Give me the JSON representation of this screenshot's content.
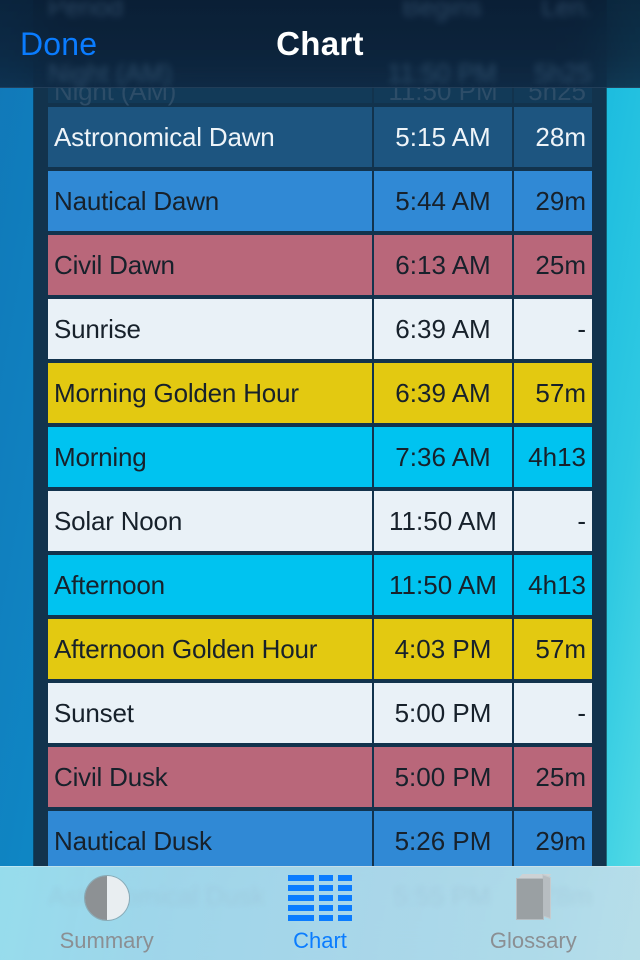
{
  "navbar": {
    "done_label": "Done",
    "title": "Chart",
    "done_color": "#0a7cff",
    "ghost": {
      "header": {
        "period": "Period",
        "begins": "Begins",
        "length": "Len."
      },
      "row": {
        "period": "Night (AM)",
        "begins": "11:50 PM",
        "length": "5h25"
      }
    }
  },
  "table": {
    "columns": [
      "Period",
      "Begins",
      "Len."
    ],
    "partial_top_row": {
      "period": "Night (AM)",
      "begins": "11:50 PM",
      "length": "5h25"
    },
    "rows": [
      {
        "period": "Astronomical Dawn",
        "begins": "5:15 AM",
        "length": "28m",
        "bg": "#1d5580",
        "fg": "#eef4f8"
      },
      {
        "period": "Nautical Dawn",
        "begins": "5:44 AM",
        "length": "29m",
        "bg": "#3089d5",
        "fg": "#17212b"
      },
      {
        "period": "Civil Dawn",
        "begins": "6:13 AM",
        "length": "25m",
        "bg": "#b9677a",
        "fg": "#17212b"
      },
      {
        "period": "Sunrise",
        "begins": "6:39 AM",
        "length": "-",
        "bg": "#e9f1f7",
        "fg": "#17212b"
      },
      {
        "period": "Morning Golden Hour",
        "begins": "6:39 AM",
        "length": "57m",
        "bg": "#e3c911",
        "fg": "#17212b"
      },
      {
        "period": "Morning",
        "begins": "7:36 AM",
        "length": "4h13",
        "bg": "#00c3f0",
        "fg": "#17212b"
      },
      {
        "period": "Solar Noon",
        "begins": "11:50 AM",
        "length": "-",
        "bg": "#e9f1f7",
        "fg": "#17212b"
      },
      {
        "period": "Afternoon",
        "begins": "11:50 AM",
        "length": "4h13",
        "bg": "#00c3f0",
        "fg": "#17212b"
      },
      {
        "period": "Afternoon Golden Hour",
        "begins": "4:03 PM",
        "length": "57m",
        "bg": "#e3c911",
        "fg": "#17212b"
      },
      {
        "period": "Sunset",
        "begins": "5:00 PM",
        "length": "-",
        "bg": "#e9f1f7",
        "fg": "#17212b"
      },
      {
        "period": "Civil Dusk",
        "begins": "5:00 PM",
        "length": "25m",
        "bg": "#b9677a",
        "fg": "#17212b"
      },
      {
        "period": "Nautical Dusk",
        "begins": "5:26 PM",
        "length": "29m",
        "bg": "#3089d5",
        "fg": "#17212b"
      },
      {
        "period": "Astronomical Dusk",
        "begins": "5:55 PM",
        "length": "28m",
        "bg": "#1d5580",
        "fg": "#eef4f8"
      }
    ]
  },
  "tabbar": {
    "ghost_row": {
      "period": "Astronomical Dusk",
      "begins": "5:55 PM",
      "length": "28m"
    },
    "tabs": [
      {
        "label": "Summary",
        "icon": "moon-phase-icon",
        "active": false
      },
      {
        "label": "Chart",
        "icon": "table-grid-icon",
        "active": true
      },
      {
        "label": "Glossary",
        "icon": "book-icon",
        "active": false
      }
    ],
    "active_color": "#0a7cff",
    "inactive_color": "#8b8f93"
  }
}
